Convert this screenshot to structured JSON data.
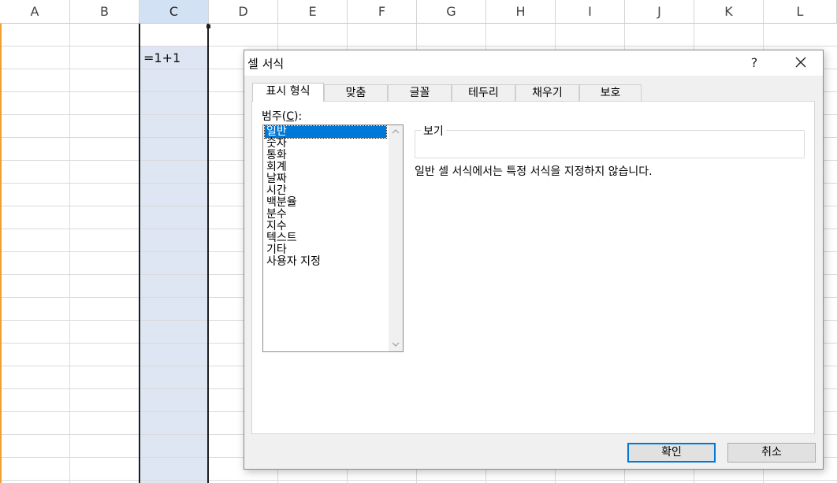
{
  "sheet": {
    "columns": [
      "A",
      "B",
      "C",
      "D",
      "E",
      "F",
      "G",
      "H",
      "I",
      "J",
      "K",
      "L"
    ],
    "selected_column": "C",
    "cell_c2": "=1+1"
  },
  "dialog": {
    "title": "셀 서식",
    "help": "?",
    "close_icon": "close-icon",
    "tabs": [
      "표시 형식",
      "맞춤",
      "글꼴",
      "테두리",
      "채우기",
      "보호"
    ],
    "active_tab": "표시 형식",
    "category_label_prefix": "범주(",
    "category_label_key": "C",
    "category_label_suffix": "):",
    "categories": [
      "일반",
      "숫자",
      "통화",
      "회계",
      "날짜",
      "시간",
      "백분율",
      "분수",
      "지수",
      "텍스트",
      "기타",
      "사용자 지정"
    ],
    "selected_category": "일반",
    "preview_label": "보기",
    "description": "일반 셀 서식에서는 특정 서식을 지정하지 않습니다.",
    "ok_label": "확인",
    "cancel_label": "취소",
    "accent": "#0078d7"
  }
}
